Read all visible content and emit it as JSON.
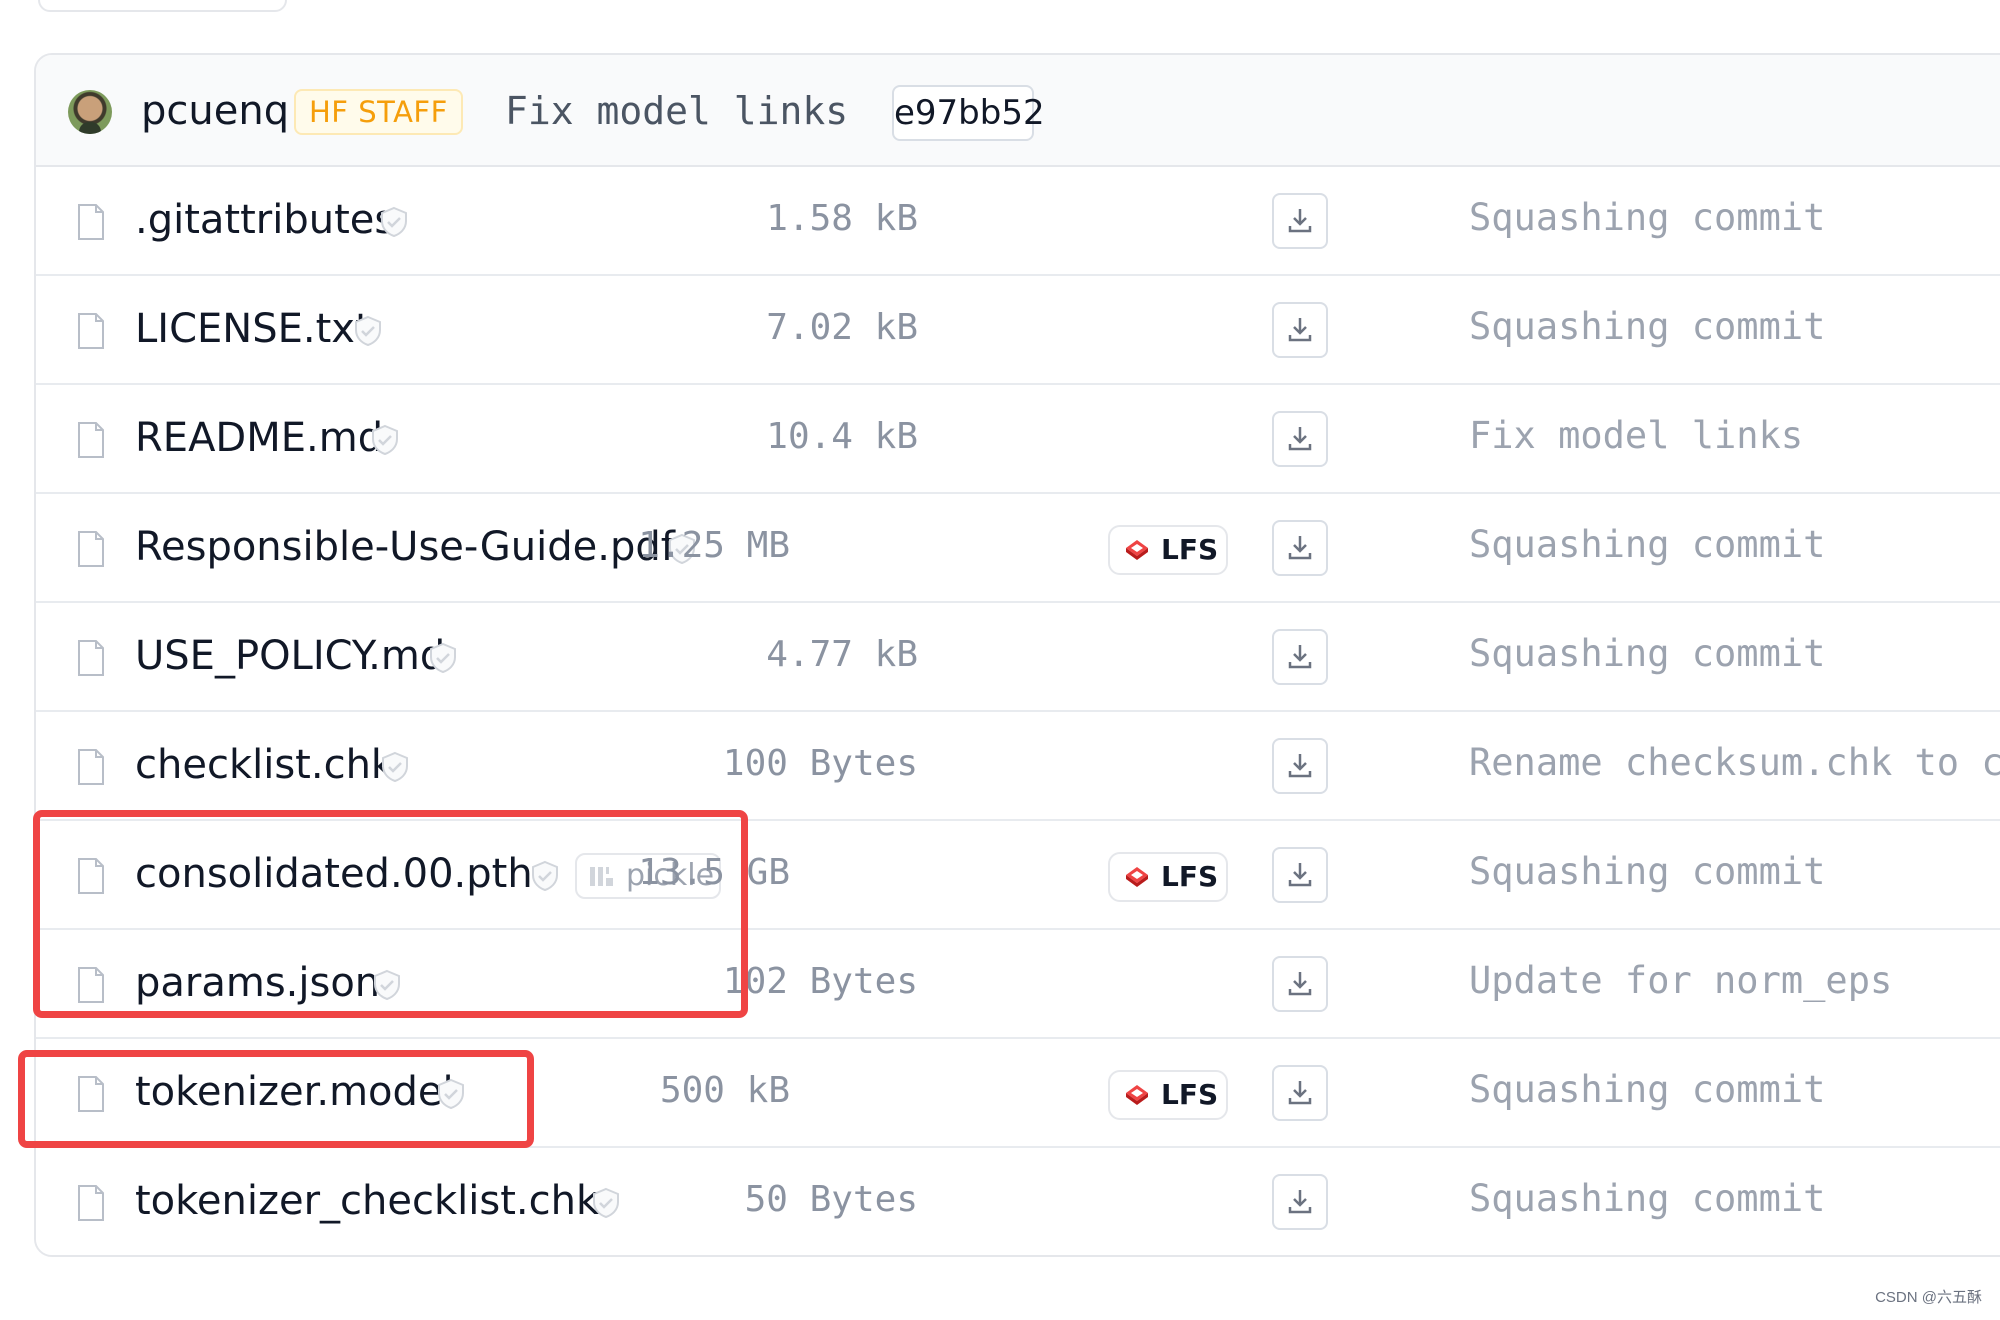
{
  "commit": {
    "author": "pcuenq",
    "author_badge": "HF STAFF",
    "message": "Fix model links",
    "hash": "e97bb52"
  },
  "files": [
    {
      "name": ".gitattributes",
      "size": "1.58 kB",
      "lfs": false,
      "pickle": false,
      "last_commit": "Squashing commit"
    },
    {
      "name": "LICENSE.txt",
      "size": "7.02 kB",
      "lfs": false,
      "pickle": false,
      "last_commit": "Squashing commit"
    },
    {
      "name": "README.md",
      "size": "10.4 kB",
      "lfs": false,
      "pickle": false,
      "last_commit": "Fix model links"
    },
    {
      "name": "Responsible-Use-Guide.pdf",
      "size": "1.25 MB",
      "lfs": true,
      "pickle": false,
      "last_commit": "Squashing commit"
    },
    {
      "name": "USE_POLICY.md",
      "size": "4.77 kB",
      "lfs": false,
      "pickle": false,
      "last_commit": "Squashing commit"
    },
    {
      "name": "checklist.chk",
      "size": "100 Bytes",
      "lfs": false,
      "pickle": false,
      "last_commit": "Rename checksum.chk to c"
    },
    {
      "name": "consolidated.00.pth",
      "size": "13.5 GB",
      "lfs": true,
      "pickle": true,
      "last_commit": "Squashing commit"
    },
    {
      "name": "params.json",
      "size": "102 Bytes",
      "lfs": false,
      "pickle": false,
      "last_commit": "Update for norm_eps"
    },
    {
      "name": "tokenizer.model",
      "size": "500 kB",
      "lfs": true,
      "pickle": false,
      "last_commit": "Squashing commit"
    },
    {
      "name": "tokenizer_checklist.chk",
      "size": "50 Bytes",
      "lfs": false,
      "pickle": false,
      "last_commit": "Squashing commit"
    }
  ],
  "badges": {
    "lfs_label": "LFS",
    "pickle_label": "pickle"
  },
  "icons": {
    "file": "file-icon",
    "safe": "shield-check-icon",
    "lfs": "git-lfs-icon",
    "pickle": "pickle-jar-icon",
    "download": "download-icon"
  },
  "colors": {
    "staff_badge_text": "#f59e0b",
    "staff_badge_bg": "#fffbeb",
    "highlight": "#ef4444",
    "lfs_red": "#ef4444",
    "muted_text": "#9ca3af"
  },
  "watermark": "CSDN @六五酥"
}
